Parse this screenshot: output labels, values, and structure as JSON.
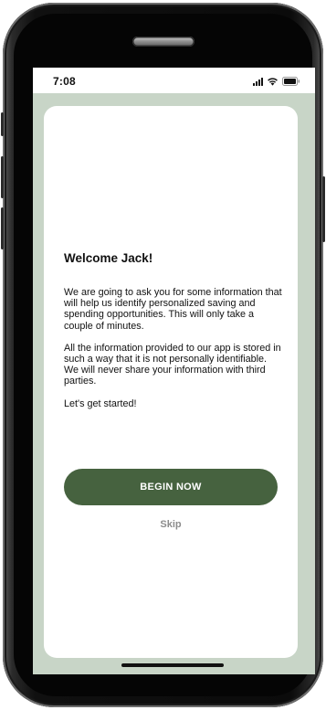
{
  "status_bar": {
    "time": "7:08",
    "icons": [
      "cellular-signal-icon",
      "wifi-icon",
      "battery-icon"
    ]
  },
  "onboarding": {
    "title": "Welcome Jack!",
    "paragraphs": [
      "We are going to ask you for some information that will help us identify personalized saving and spending opportunities. This will only take a couple of minutes.",
      "All the information provided to our app is stored in such a way that it is not personally identifiable. We will never share your information with third parties.",
      "Let's get started!"
    ],
    "primary_button_label": "BEGIN NOW",
    "skip_label": "Skip"
  },
  "colors": {
    "background": "#c8d5c7",
    "card": "#ffffff",
    "primary_button": "#46623f",
    "skip_text": "#8c8c8c"
  }
}
